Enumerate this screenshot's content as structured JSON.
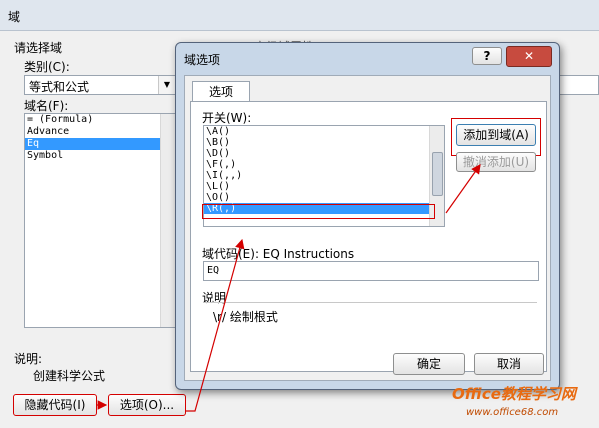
{
  "outer": {
    "title": "域",
    "section_label": "请选择域",
    "category_label": "类别(C):",
    "category_value": "等式和公式",
    "fieldname_label": "域名(F):",
    "field_list": [
      "= (Formula)",
      "Advance",
      "Eq",
      "Symbol"
    ],
    "selected_index": 2,
    "desc_label": "说明:",
    "desc_text": "创建科学公式",
    "hide_codes_button": "隐藏代码(I)",
    "options_button": "选项(O)...",
    "behind_header_fragment": "高级域属性"
  },
  "inner": {
    "title": "域选项",
    "help_button": "?",
    "close_button": "✕",
    "tab_label": "选项",
    "switches_label": "开关(W):",
    "switches": [
      "\\A()",
      "\\B()",
      "\\D()",
      "\\F(,)",
      "\\I(,,)",
      "\\L()",
      "\\O()",
      "\\R(,)"
    ],
    "selected_switch_index": 7,
    "add_button": "添加到域(A)",
    "remove_button": "撤消添加(U)",
    "field_codes_label": "域代码(E): EQ Instructions",
    "field_codes_value": "EQ",
    "desc_label": "说明",
    "desc_text": "\\r/ 绘制根式",
    "ok_button": "确定",
    "cancel_button": "取消"
  },
  "watermark": {
    "line1": "Office教程学习网",
    "line2": "www.office68.com"
  },
  "colors": {
    "annotation_red": "#d40000",
    "selection_blue": "#3399ff"
  }
}
